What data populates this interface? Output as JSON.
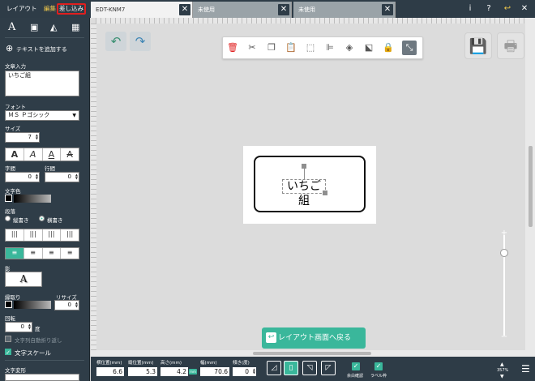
{
  "top_bar": {
    "mode_layout": "レイアウト",
    "mode_edit": "編集",
    "mode_print": "差し込み",
    "help_label": "?"
  },
  "tabs": [
    {
      "label": "EDT-KNM7"
    },
    {
      "label": "未使用"
    },
    {
      "label": "未使用"
    }
  ],
  "sidebar": {
    "add_text": "テキストを追加する",
    "text_input_label": "文章入力",
    "text_value": "いちご組",
    "font_label": "フォント",
    "font_value": "ＭＳ Ｐゴシック",
    "size_label": "サイズ",
    "size_value": "7",
    "char_spacing_label": "字間",
    "char_spacing_value": "0",
    "line_spacing_label": "行間",
    "line_spacing_value": "0",
    "text_color_label": "文字色",
    "paragraph_label": "段落",
    "vertical_label": "縦書き",
    "horizontal_label": "横書き",
    "shadow_label": "影",
    "shadow_sample": "A",
    "outline_label": "縁取り",
    "outline_size_label": "リサイズ",
    "outline_size_value": "0",
    "rotation_label": "回転",
    "rotation_value": "0",
    "degree_unit": "度",
    "wrap_label": "文字列自動折り返し",
    "text_scale_label": "文字スケール",
    "text_deform_label": "文字変形"
  },
  "canvas": {
    "label_text": "いちご組",
    "back_button": "レイアウト画面へ戻る"
  },
  "bottom_bar": {
    "h_pos_label": "横位置(mm)",
    "h_pos_value": "6.6",
    "v_pos_label": "縦位置(mm)",
    "v_pos_value": "5.3",
    "height_label": "高さ(mm)",
    "height_value": "4.2",
    "mm_badge": "mm",
    "width_label": "幅(mm)",
    "width_value": "70.6",
    "tilt_label": "傾き(度)",
    "tilt_value": "0",
    "check1": "余白確認",
    "check2": "ラベル枠",
    "zoom": "357%"
  },
  "colors": {
    "accent": "#3ab79b",
    "panel": "#2f3d48",
    "highlight": "#e01f1f"
  }
}
